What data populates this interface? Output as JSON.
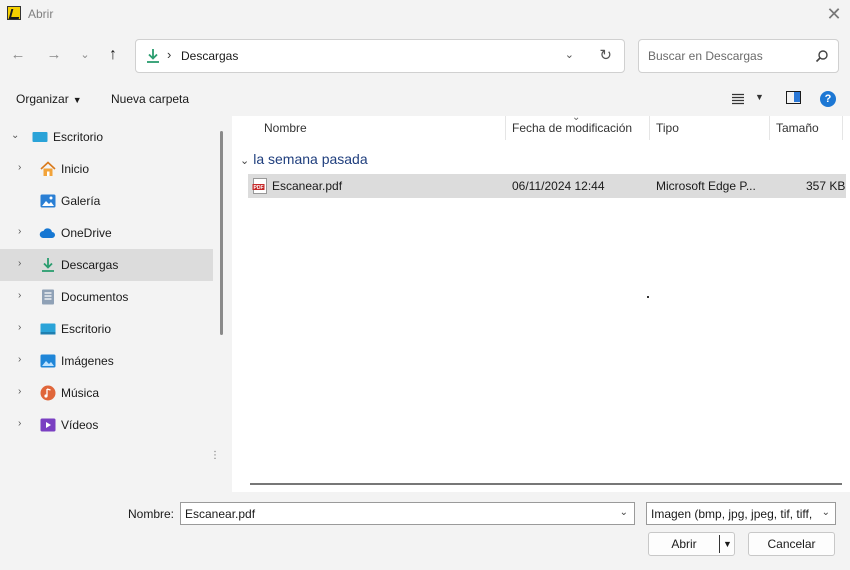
{
  "window": {
    "title": "Abrir"
  },
  "address": {
    "path": "Descargas"
  },
  "search": {
    "placeholder": "Buscar en Descargas"
  },
  "toolbar": {
    "organize": "Organizar",
    "new_folder": "Nueva carpeta"
  },
  "sidebar": {
    "items": [
      {
        "label": "Escritorio",
        "icon": "desktop-icon"
      },
      {
        "label": "Inicio",
        "icon": "home-icon"
      },
      {
        "label": "Galería",
        "icon": "gallery-icon"
      },
      {
        "label": "OneDrive",
        "icon": "cloud-icon"
      },
      {
        "label": "Descargas",
        "icon": "download-icon",
        "selected": true
      },
      {
        "label": "Documentos",
        "icon": "documents-icon"
      },
      {
        "label": "Escritorio",
        "icon": "desktop-icon"
      },
      {
        "label": "Imágenes",
        "icon": "pictures-icon"
      },
      {
        "label": "Música",
        "icon": "music-icon"
      },
      {
        "label": "Vídeos",
        "icon": "videos-icon"
      }
    ]
  },
  "columns": {
    "name": "Nombre",
    "modified": "Fecha de modificación",
    "type": "Tipo",
    "size": "Tamaño"
  },
  "groups": [
    {
      "label": "la semana pasada",
      "files": [
        {
          "name": "Escanear.pdf",
          "modified": "06/11/2024 12:44",
          "type": "Microsoft Edge P...",
          "size": "357 KB",
          "icon": "pdf-icon"
        }
      ]
    }
  ],
  "footer": {
    "name_label": "Nombre:",
    "name_value": "Escanear.pdf",
    "filter": "Imagen (bmp, jpg, jpeg, tif, tiff,",
    "open": "Abrir",
    "cancel": "Cancelar"
  },
  "colors": {
    "accent": "#1c77d4",
    "selection": "#dcdcdc",
    "group_header": "#1f3e7d",
    "pdf": "#c62828"
  }
}
